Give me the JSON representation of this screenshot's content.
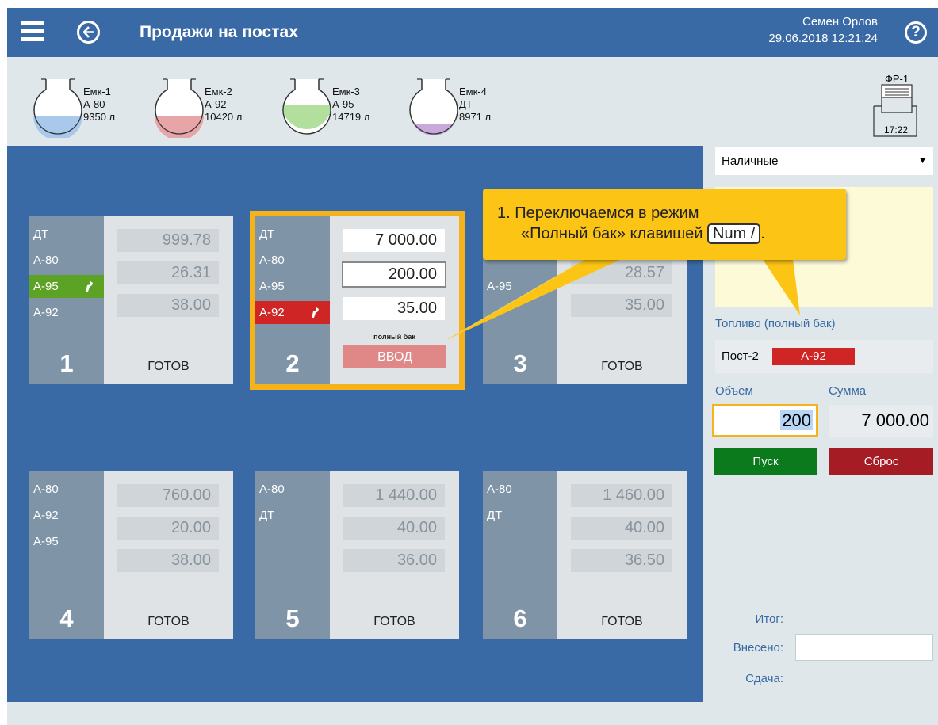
{
  "header": {
    "title": "Продажи на постах",
    "user": "Семен Орлов",
    "datetime": "29.06.2018 12:21:24",
    "help": "?"
  },
  "tanks": [
    {
      "name": "Емк-1",
      "fuel": "А-80",
      "volume": "9350 л",
      "color": "#a8c8ec",
      "level": 0.45
    },
    {
      "name": "Емк-2",
      "fuel": "А-92",
      "volume": "10420 л",
      "color": "#e8a5a8",
      "level": 0.45
    },
    {
      "name": "Емк-3",
      "fuel": "А-95",
      "volume": "14719 л",
      "color": "#b2df9c",
      "level": 0.6
    },
    {
      "name": "Емк-4",
      "fuel": "ДТ",
      "volume": "8971 л",
      "color": "#c9a8da",
      "level": 0.28
    }
  ],
  "printer": {
    "name": "ФР-1",
    "time": "17:22"
  },
  "posts": [
    {
      "number": "1",
      "status": "ГОТОВ",
      "fuels": [
        "ДТ",
        "А-80",
        "А-95",
        "А-92"
      ],
      "values": [
        "999.78",
        "26.31",
        "38.00"
      ]
    },
    {
      "number": "2",
      "fuels": [
        "ДТ",
        "А-80",
        "А-95",
        "А-92"
      ],
      "values": [
        "7 000.00",
        "200.00",
        "35.00"
      ],
      "mode": "полный бак",
      "enter": "ВВОД"
    },
    {
      "number": "3",
      "status": "ГОТОВ",
      "fuels": [
        "А-95"
      ],
      "values": [
        "28.57",
        "35.00"
      ]
    },
    {
      "number": "4",
      "status": "ГОТОВ",
      "fuels": [
        "А-80",
        "А-92",
        "А-95"
      ],
      "values": [
        "760.00",
        "20.00",
        "38.00"
      ]
    },
    {
      "number": "5",
      "status": "ГОТОВ",
      "fuels": [
        "А-80",
        "ДТ"
      ],
      "values": [
        "1 440.00",
        "40.00",
        "36.00"
      ]
    },
    {
      "number": "6",
      "status": "ГОТОВ",
      "fuels": [
        "А-80",
        "ДТ"
      ],
      "values": [
        "1 460.00",
        "40.00",
        "36.50"
      ]
    }
  ],
  "payment": {
    "selected": "Наличные",
    "arrow": "▼"
  },
  "fuel_panel": {
    "title": "Топливо (полный бак)",
    "post": "Пост-2",
    "fuel": "А-92",
    "volume_label": "Объем",
    "sum_label": "Сумма",
    "volume": "200",
    "sum": "7 000.00",
    "start": "Пуск",
    "reset": "Сброс"
  },
  "totals": {
    "total": "Итог:",
    "paid": "Внесено:",
    "change": "Сдача:"
  },
  "callout": {
    "line1": "1. Переключаемся в режим",
    "line2": "«Полный бак» клавишей",
    "key": "Num /",
    "end": "."
  },
  "colors": {
    "header": "#3a6aa5",
    "active_highlight": "#f5b21b",
    "green_fuel": "#5ca224",
    "red_fuel": "#cf2525",
    "start": "#0a7a1c",
    "reset": "#a51c25"
  }
}
